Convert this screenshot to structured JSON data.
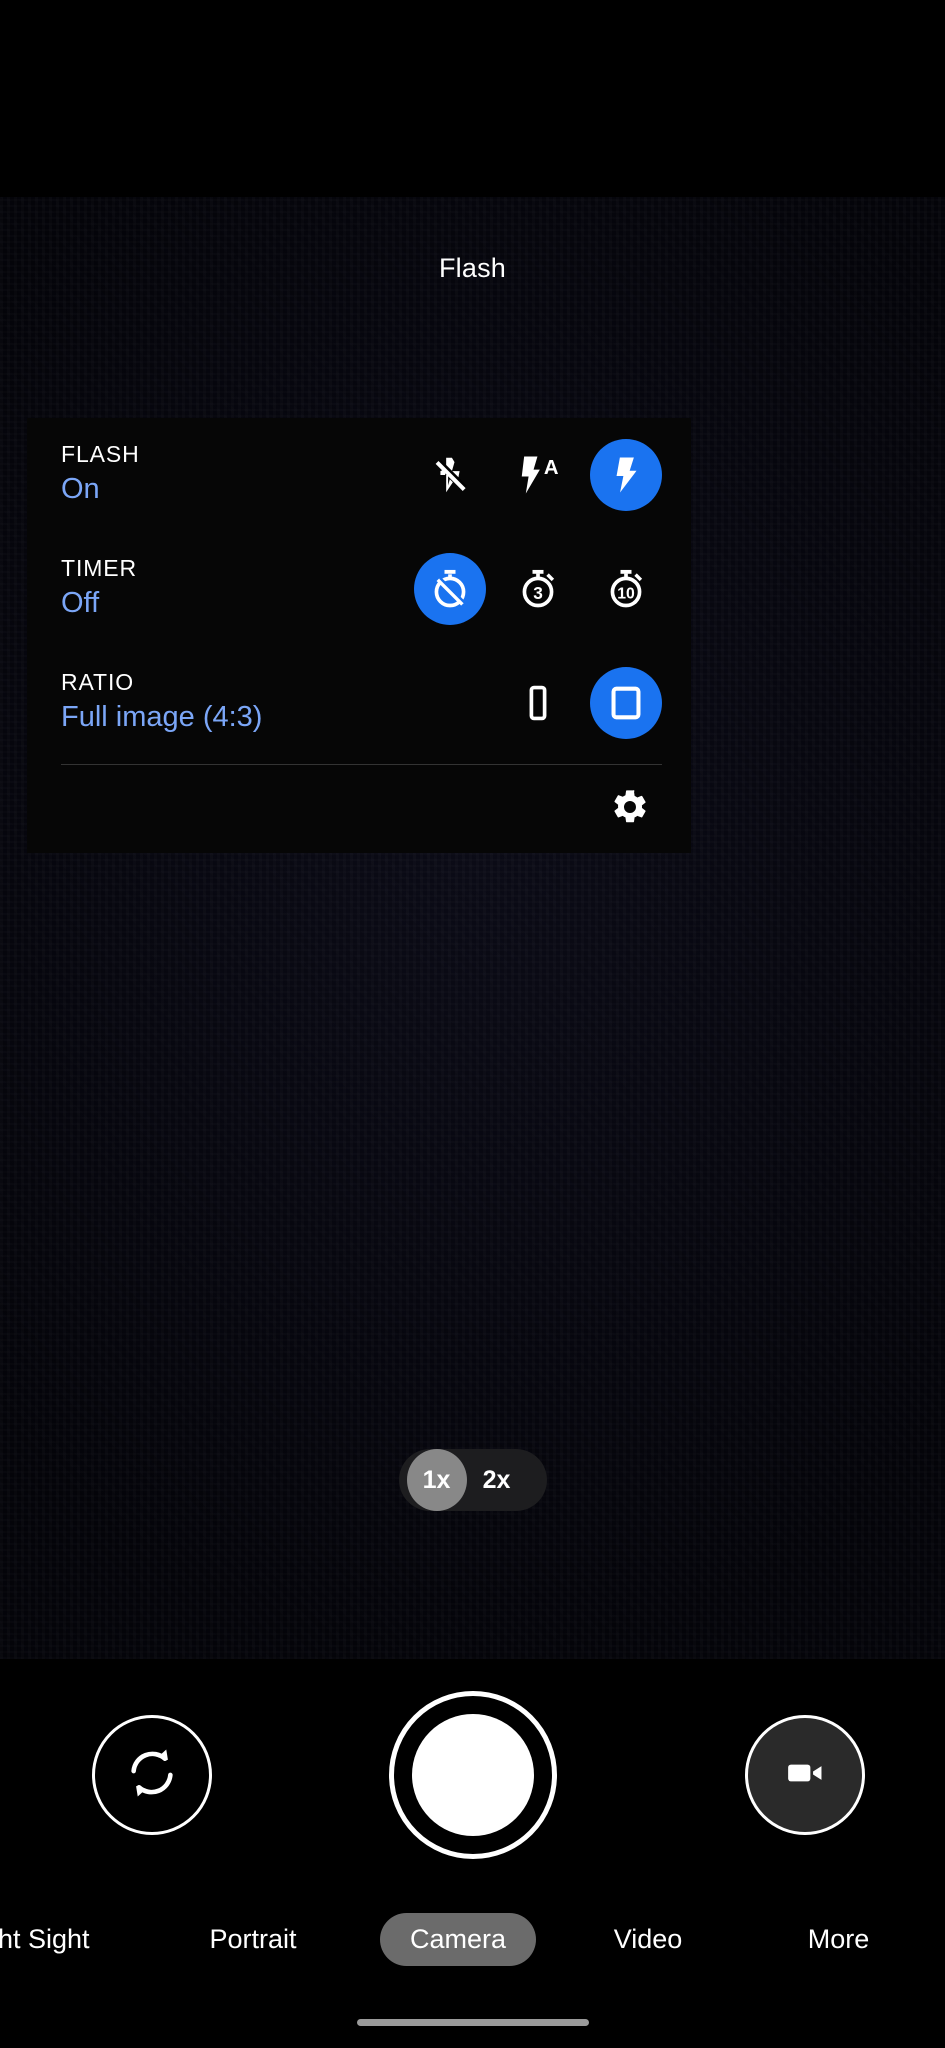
{
  "tooltip": {
    "text": "Flash"
  },
  "colors": {
    "accent_blue": "#1a73f0",
    "value_blue": "#7ba6f7",
    "panel_bg": "#060606",
    "selected_mode_pill": "#6b6b6b",
    "zoom_active_pill": "#888888"
  },
  "settings_panel": {
    "rows": [
      {
        "title": "FLASH",
        "value": "On",
        "options": [
          {
            "icon": "flash-off-icon",
            "selected": false
          },
          {
            "icon": "flash-auto-icon",
            "selected": false
          },
          {
            "icon": "flash-on-icon",
            "selected": true
          }
        ]
      },
      {
        "title": "TIMER",
        "value": "Off",
        "options": [
          {
            "icon": "timer-off-icon",
            "selected": true
          },
          {
            "icon": "timer-3-seconds-icon",
            "selected": false
          },
          {
            "icon": "timer-10-seconds-icon",
            "selected": false
          }
        ]
      },
      {
        "title": "RATIO",
        "value": "Full image (4:3)",
        "options": [
          {
            "icon": "aspect-ratio-16-9-icon",
            "selected": false
          },
          {
            "icon": "aspect-ratio-4-3-icon",
            "selected": true
          }
        ]
      }
    ],
    "footer": {
      "settings_icon": "gear-icon"
    }
  },
  "zoom_control": {
    "levels": [
      {
        "label": "1x",
        "active": true
      },
      {
        "label": "2x",
        "active": false
      }
    ]
  },
  "bottom_controls": {
    "flip_camera_icon": "flip-camera-icon",
    "shutter_icon": "shutter-button",
    "video_icon": "video-camera-icon"
  },
  "mode_bar": {
    "modes": [
      {
        "label": "ht Sight",
        "active": false
      },
      {
        "label": "Portrait",
        "active": false
      },
      {
        "label": "Camera",
        "active": true
      },
      {
        "label": "Video",
        "active": false
      },
      {
        "label": "More",
        "active": false
      }
    ]
  }
}
